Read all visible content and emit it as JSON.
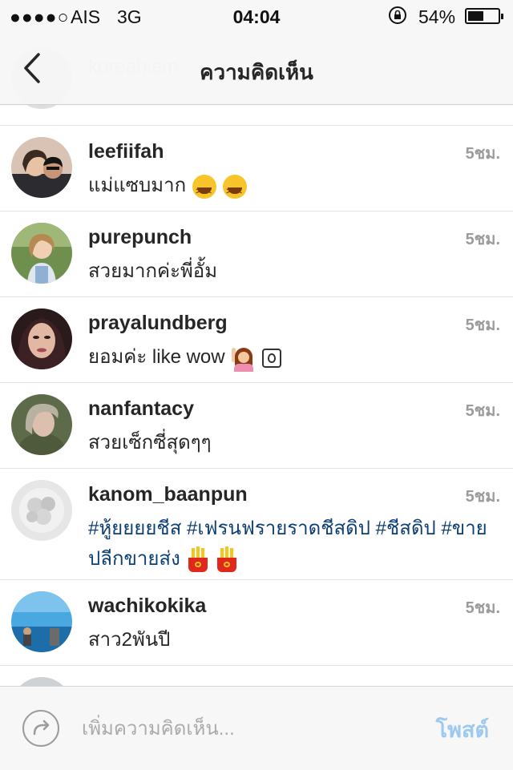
{
  "status_bar": {
    "signal": "●●●●○",
    "carrier": "AIS",
    "network": "3G",
    "time": "04:04",
    "battery": "54%",
    "battery_level": 0.54
  },
  "nav": {
    "title": "ความคิดเห็น",
    "partial_username": "koreahiem"
  },
  "comments": [
    {
      "username": "leefiifah",
      "time": "5ชม.",
      "text": "แม่แซบมาก"
    },
    {
      "username": "purepunch",
      "time": "5ชม.",
      "text": "สวยมากค่ะพี่อั้ม"
    },
    {
      "username": "prayalundberg",
      "time": "5ชม.",
      "text": "ยอมค่ะ like wow"
    },
    {
      "username": "nanfantacy",
      "time": "5ชม.",
      "text": "สวยเซ็กซี่สุดๆๆ"
    },
    {
      "username": "kanom_baanpun",
      "time": "5ชม.",
      "text_line1": "#หู้ยยยยชีส #เฟรนฟรายราดชีสดิป #ชีสดิป #ขาย",
      "text_line2": "ปลีกขายส่ง"
    },
    {
      "username": "wachikokika",
      "time": "5ชม.",
      "text": "สาว2พันปี"
    }
  ],
  "input_bar": {
    "placeholder": "เพิ่มความคิดเห็น...",
    "post_label": "โพสต์"
  }
}
